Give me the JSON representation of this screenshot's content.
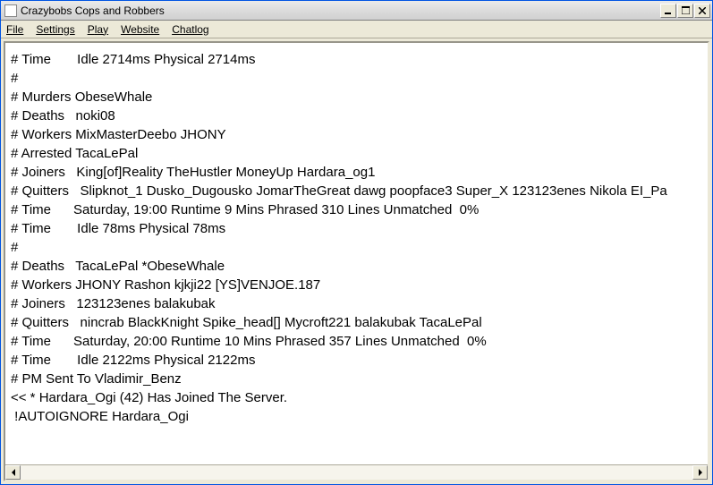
{
  "window": {
    "title": "Crazybobs Cops and Robbers"
  },
  "menu": {
    "file": "File",
    "settings": "Settings",
    "play": "Play",
    "website": "Website",
    "chatlog": "Chatlog"
  },
  "log": {
    "lines": [
      "# Time       Idle 2714ms Physical 2714ms",
      "#",
      "# Murders ObeseWhale",
      "# Deaths   noki08",
      "# Workers MixMasterDeebo JHONY",
      "# Arrested TacaLePal",
      "# Joiners   King[of]Reality TheHustler MoneyUp Hardara_og1",
      "# Quitters   Slipknot_1 Dusko_Dugousko JomarTheGreat dawg poopface3 Super_X 123123enes Nikola EI_Pa",
      "# Time      Saturday, 19:00 Runtime 9 Mins Phrased 310 Lines Unmatched  0%",
      "# Time       Idle 78ms Physical 78ms",
      "#",
      "# Deaths   TacaLePal *ObeseWhale",
      "# Workers JHONY Rashon kjkji22 [YS]VENJOE.187",
      "# Joiners   123123enes balakubak",
      "# Quitters   nincrab BlackKnight Spike_head[] Mycroft221 balakubak TacaLePal",
      "# Time      Saturday, 20:00 Runtime 10 Mins Phrased 357 Lines Unmatched  0%",
      "# Time       Idle 2122ms Physical 2122ms",
      "# PM Sent To Vladimir_Benz",
      "<< * Hardara_Ogi (42) Has Joined The Server.",
      " !AUTOIGNORE Hardara_Ogi"
    ]
  }
}
